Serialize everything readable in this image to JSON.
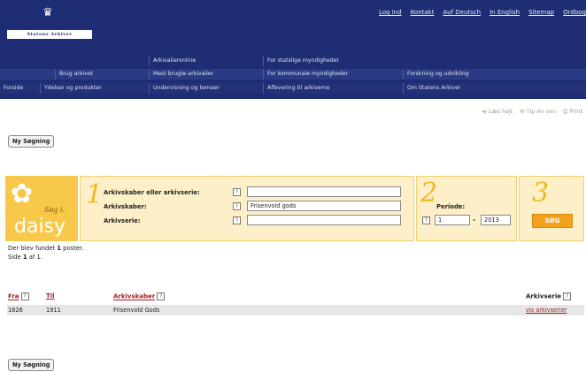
{
  "header": {
    "logo_text": "Statens Arkiver",
    "top_links": [
      "Log ind",
      "Kontakt",
      "Auf Deutsch",
      "In English",
      "Sitemap",
      "Ordbog"
    ],
    "nav_row1": [
      "Arkivalieronline",
      "For statslige myndigheder"
    ],
    "nav_row2": [
      "Brug arkivet",
      "Mest brugte arkivalier",
      "For kommunale myndigheder",
      "Forskning og udvikling"
    ],
    "nav_row3": [
      "Forside",
      "Ydelser og produkter",
      "Undervisning og temaer",
      "Aflevering til arkiverne",
      "Om Statens Arkiver"
    ]
  },
  "tools": [
    "Læs højt",
    "Tip en ven",
    "Print"
  ],
  "new_search_label": "Ny Søgning",
  "daisy": {
    "word": "daisy",
    "sub": "Søg i:"
  },
  "form": {
    "step1": "1",
    "step2": "2",
    "step3": "3",
    "label_arkivskaber_eller": "Arkivskaber eller arkivserie:",
    "label_arkivskaber": "Arkivskaber:",
    "label_arkivserie": "Arkivserie:",
    "value_arkivskaber_eller": "",
    "value_arkivskaber": "Frisenvold gods",
    "value_arkivserie": "",
    "label_periode": "Periode:",
    "periode_from": "1",
    "periode_sep": "–",
    "periode_to": "2013",
    "search_button": "SØG",
    "help": "?"
  },
  "results": {
    "found_prefix": "Der blev fundet ",
    "found_count": "1",
    "found_suffix": " poster.",
    "page_prefix": "Side ",
    "page_current": "1",
    "page_mid": " af ",
    "page_total": "1",
    "page_end": "."
  },
  "table": {
    "headers": {
      "fra": "Fra",
      "til": "Til",
      "arkivskaber": "Arkivskaber",
      "arkivserie": "Arkivserie"
    },
    "rows": [
      {
        "fra": "1626",
        "til": "1911",
        "arkivskaber": "Frisenvold Gods",
        "arkivserie": "vis arkivserier"
      }
    ]
  }
}
